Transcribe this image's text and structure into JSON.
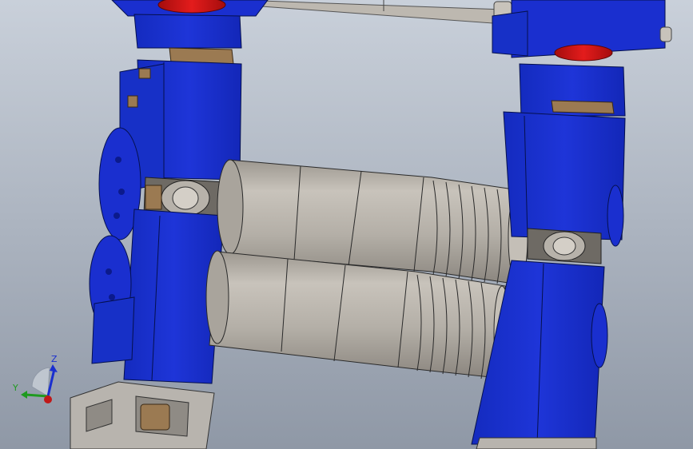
{
  "viewport": {
    "background_top": "#c9d0da",
    "background_bottom": "#8f98a6"
  },
  "colors": {
    "housing_blue": "#1a2fcf",
    "housing_dark": "#0b1a8c",
    "housing_light": "#3a52e6",
    "roll_grey": "#b7b2aa",
    "roll_shadow": "#8e8a84",
    "roll_highlight": "#d4cfc7",
    "cap_red": "#d11414",
    "bronze": "#9b7a52",
    "base_grey": "#b8b4ae"
  },
  "triad": {
    "z_label": "Z",
    "y_label": "Y",
    "z_color": "#1a2fcf",
    "y_color": "#1f9a1f",
    "origin_color": "#c01818"
  }
}
